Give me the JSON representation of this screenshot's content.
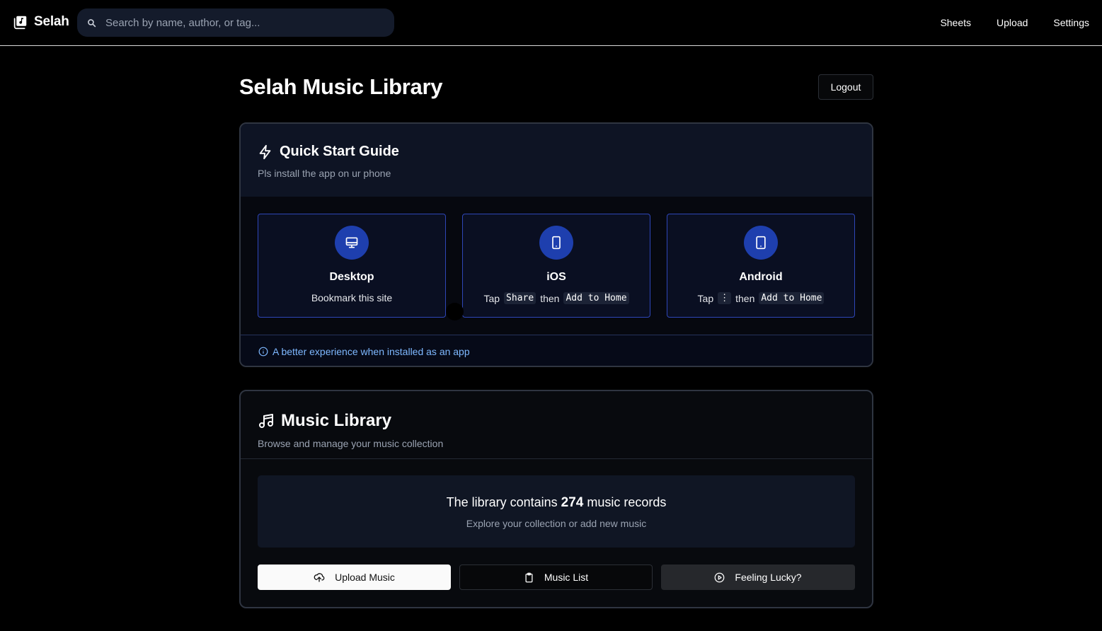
{
  "app": {
    "brand_name": "Selah",
    "search_placeholder": "Search by name, author, or tag...",
    "nav": [
      "Sheets",
      "Upload",
      "Settings"
    ]
  },
  "header": {
    "title": "Selah Music Library",
    "logout_label": "Logout"
  },
  "quick_start": {
    "title": "Quick Start Guide",
    "subtitle": "Pls install the app on ur phone",
    "platforms": [
      {
        "name": "Desktop",
        "icon": "monitor-icon",
        "desc_text": "Bookmark this site"
      },
      {
        "name": "iOS",
        "icon": "phone-icon",
        "tap": "Tap",
        "key1": "Share",
        "then": "then",
        "key2": "Add to Home"
      },
      {
        "name": "Android",
        "icon": "phone-icon",
        "tap": "Tap",
        "key1": "⋮",
        "then": "then",
        "key2": "Add to Home"
      }
    ],
    "footer_note": "A better experience when installed as an app"
  },
  "music_library": {
    "title": "Music Library",
    "subtitle": "Browse and manage your music collection",
    "stats_prefix": "The library contains",
    "record_count": "274",
    "stats_suffix": "music records",
    "stats_sub": "Explore your collection or add new music",
    "buttons": {
      "upload": "Upload Music",
      "list": "Music List",
      "lucky": "Feeling Lucky?"
    }
  },
  "colors": {
    "accent_blue": "#1e3fae",
    "info_text": "#7eb8ff",
    "background": "#000000"
  }
}
